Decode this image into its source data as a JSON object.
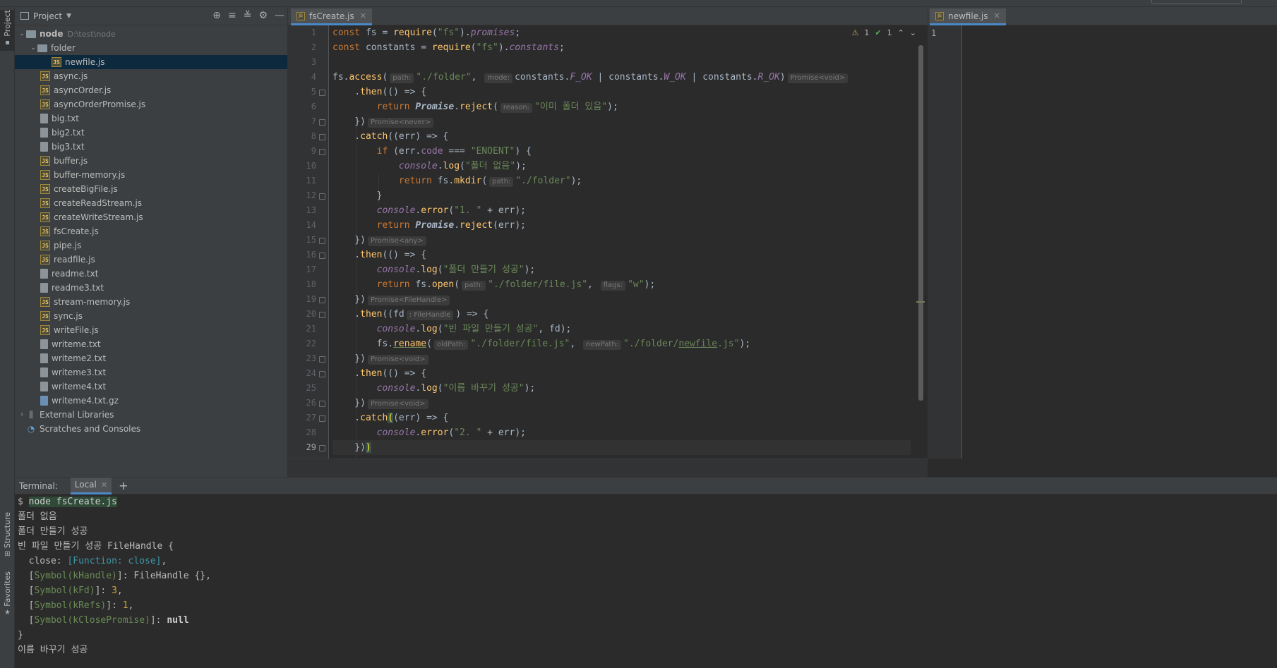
{
  "left_strip": {
    "project_tab": "Project",
    "structure_tab": "Structure",
    "favorites_tab": "Favorites"
  },
  "project_panel": {
    "title": "Project",
    "root": {
      "name": "node",
      "path": "D:\\test\\node"
    },
    "folder": "folder",
    "folder_child": "newfile.js",
    "files": [
      "async.js",
      "asyncOrder.js",
      "asyncOrderPromise.js",
      "big.txt",
      "big2.txt",
      "big3.txt",
      "buffer.js",
      "buffer-memory.js",
      "createBigFile.js",
      "createReadStream.js",
      "createWriteStream.js",
      "fsCreate.js",
      "pipe.js",
      "readfile.js",
      "readme.txt",
      "readme3.txt",
      "stream-memory.js",
      "sync.js",
      "writeFile.js",
      "writeme.txt",
      "writeme2.txt",
      "writeme3.txt",
      "writeme4.txt",
      "writeme4.txt.gz"
    ],
    "file_types": [
      "js",
      "js",
      "js",
      "txt",
      "txt",
      "txt",
      "js",
      "js",
      "js",
      "js",
      "js",
      "js",
      "js",
      "js",
      "txt",
      "txt",
      "js",
      "js",
      "js",
      "txt",
      "txt",
      "txt",
      "txt",
      "gz"
    ],
    "external_libraries": "External Libraries",
    "scratches": "Scratches and Consoles"
  },
  "editor_tab": "fsCreate.js",
  "right_tab": "newfile.js",
  "inspections": {
    "warnings": "1",
    "ok": "1"
  },
  "right_editor": {
    "line_number": "1"
  },
  "terminal": {
    "label": "Terminal:",
    "tab": "Local",
    "prompt": "$ ",
    "command": "node fsCreate.js",
    "line1": "폴더 없음",
    "line2": "폴더 만들기 성공",
    "line3": "빈 파일 만들기 성공 FileHandle {",
    "close_key": "  close: ",
    "close_val": "[Function: close]",
    "sym1": "Symbol(kHandle)",
    "sym1_val": ": FileHandle {},",
    "sym2": "Symbol(kFd)",
    "sym2_val": "3",
    "sym3": "Symbol(kRefs)",
    "sym3_val": "1",
    "sym4": "Symbol(kClosePromise)",
    "sym4_val": "null",
    "close_brace": "}",
    "last": "이름 바꾸기 성공"
  }
}
